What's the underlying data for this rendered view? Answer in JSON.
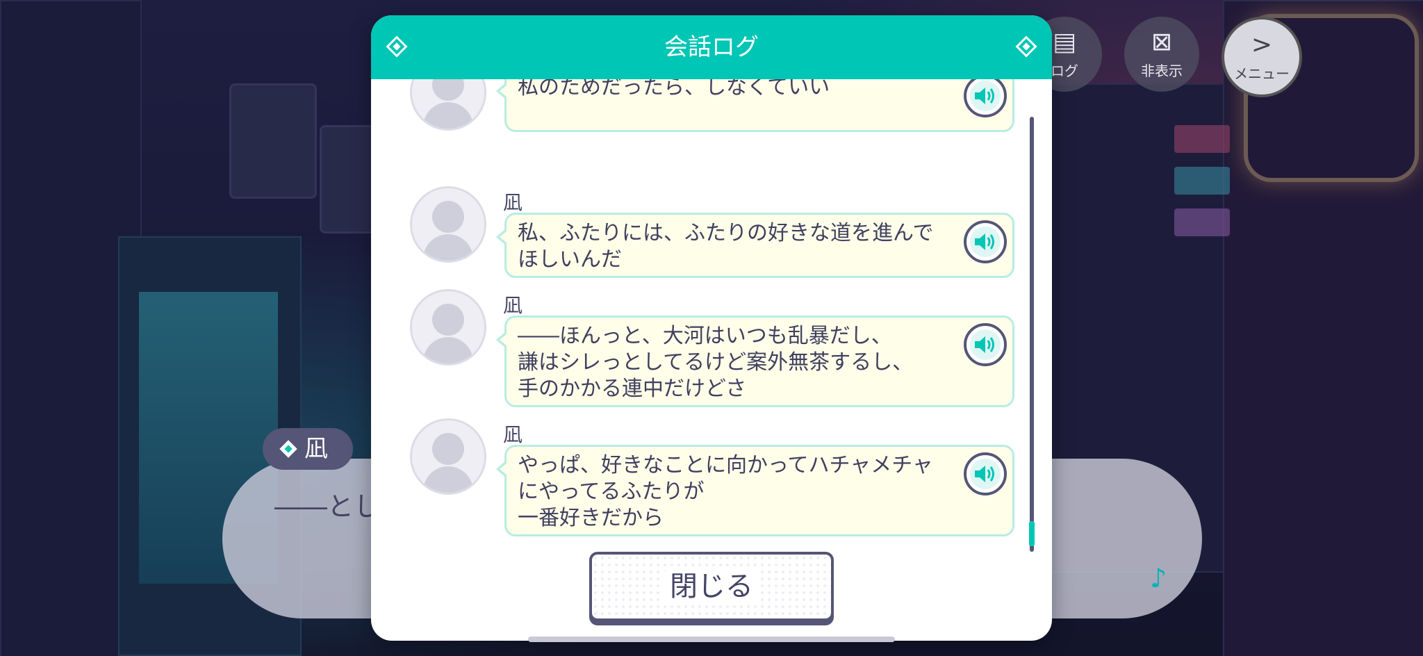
{
  "background_dialog": {
    "speaker": "凪",
    "text_fragment_left": "――とし",
    "text_fragment_right": "："
  },
  "top_buttons": {
    "log_label": "ログ",
    "hide_label": "非表示",
    "menu_label": "メニュー"
  },
  "modal": {
    "title": "会話ログ",
    "close_label": "閉じる"
  },
  "log": [
    {
      "speaker": "",
      "text": "私のためだったら、しなくていい"
    },
    {
      "speaker": "凪",
      "text": "私、ふたりには、ふたりの好きな道を進んで\nほしいんだ"
    },
    {
      "speaker": "凪",
      "text": "――ほんっと、大河はいつも乱暴だし、\n謙はシレっとしてるけど案外無茶するし、\n手のかかる連中だけどさ"
    },
    {
      "speaker": "凪",
      "text": "やっぱ、好きなことに向かってハチャメチャ\nにやってるふたりが\n一番好きだから"
    }
  ],
  "colors": {
    "accent": "#00c6b5",
    "bubble_bg": "#fefee9",
    "bubble_border": "#b9ece3",
    "text": "#3f3f5e"
  },
  "icons": {
    "voice": "speaker-volume-icon",
    "log": "speech-bubble-icon",
    "hide": "x-box-icon",
    "menu": "chevron-right-icon",
    "note": "music-note-icon"
  }
}
